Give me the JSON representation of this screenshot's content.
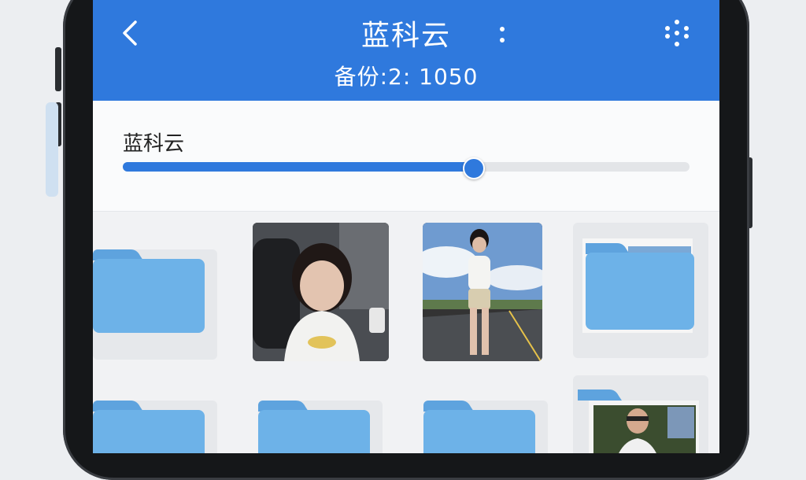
{
  "header": {
    "back_icon": "chevron-left-icon",
    "title": "蓝科云",
    "subtitle": "备份:2: 1050",
    "more_icon": "vertical-dots-icon",
    "grid_icon": "dots-grid-icon",
    "color": "#2f79dd"
  },
  "control": {
    "label": "蓝科云",
    "slider_fraction": 0.62
  },
  "gallery": {
    "items": [
      {
        "type": "folder",
        "icon": "folder-icon"
      },
      {
        "type": "photo",
        "description": "selfie-photo"
      },
      {
        "type": "photo",
        "description": "standing-portrait-photo"
      },
      {
        "type": "folder",
        "icon": "folder-icon"
      },
      {
        "type": "folder",
        "icon": "folder-icon"
      },
      {
        "type": "folder",
        "icon": "folder-icon"
      },
      {
        "type": "folder",
        "icon": "folder-icon"
      },
      {
        "type": "folder",
        "icon": "folder-with-photo-icon"
      }
    ]
  }
}
